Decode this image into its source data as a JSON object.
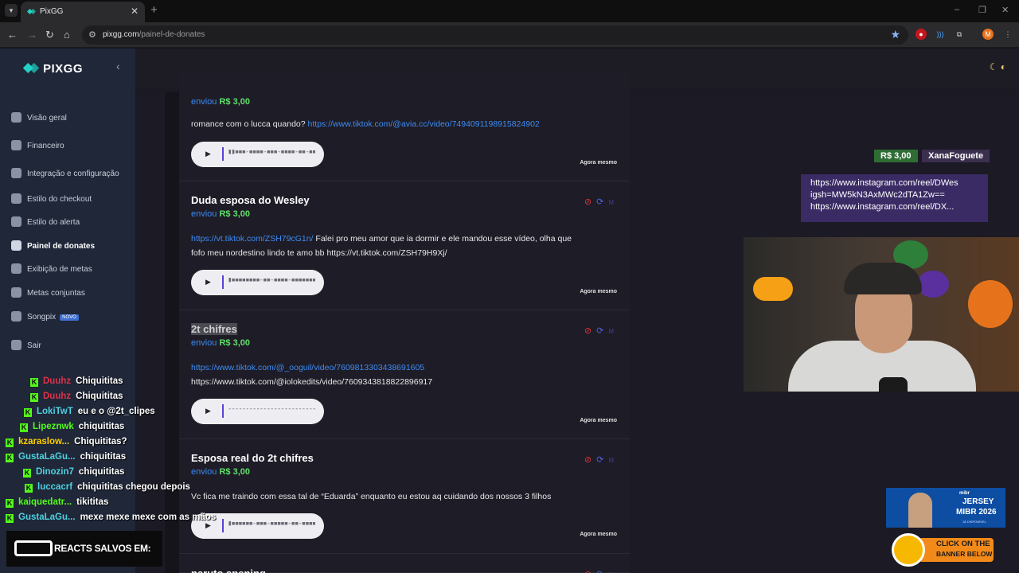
{
  "browser": {
    "tab_title": "PixGG",
    "tab_close": "✕",
    "new_tab": "+",
    "url_domain": "pixgg.com",
    "url_path": "/painel-de-donates",
    "profile_initial": "M",
    "window_controls": [
      "–",
      "❐",
      "✕"
    ]
  },
  "sidebar": {
    "logo": "PIXGG",
    "items": [
      {
        "label": "Visão geral",
        "icon": "home-icon"
      },
      {
        "label": "Financeiro",
        "icon": "wallet-icon"
      },
      {
        "label": "Integração e configuração",
        "icon": "settings-icon"
      },
      {
        "label": "Estilo do checkout",
        "icon": "palette-icon"
      },
      {
        "label": "Estilo do alerta",
        "icon": "palette-icon"
      },
      {
        "label": "Painel de donates",
        "icon": "panel-icon"
      },
      {
        "label": "Exibição de metas",
        "icon": "star-icon"
      },
      {
        "label": "Metas conjuntas",
        "icon": "users-icon"
      },
      {
        "label": "Songpix",
        "icon": "music-icon",
        "badge": "NOVO"
      },
      {
        "label": "Sair",
        "icon": "logout-icon"
      }
    ],
    "active_index": 5
  },
  "feed": {
    "cards": [
      {
        "donor": "",
        "sent_label": "enviou",
        "amount": "R$ 3,00",
        "message_text": "romance com o lucca quando? ",
        "message_link": "https://www.tiktok.com/@avia.cc/video/7494091198915824902",
        "message_line2": "",
        "waveform": "▮▮▪▪▪-▪▪▪▪-▪▪▪-▪▪▪▪-▪▪-▪▪▪-▪▪▪▪",
        "time": "Agora mesmo"
      },
      {
        "donor": "Duda esposa do Wesley",
        "sent_label": "enviou",
        "amount": "R$ 3,00",
        "message_link": "https://vt.tiktok.com/ZSH79cG1n/",
        "message_text": " Falei pro meu amor que ia dormir e ele mandou esse vídeo, olha que",
        "message_line2": "fofo meu nordestino lindo te amo bb https://vt.tiktok.com/ZSH79H9Xj/",
        "waveform": "▮▪▪▪▪▪▪▪▪-▪▪-▪▪▪▪-▪▪▪▪▪▪▪",
        "time": "Agora mesmo"
      },
      {
        "donor": "2t chifres",
        "sent_label": "enviou",
        "amount": "R$ 3,00",
        "message_link": "https://www.tiktok.com/@_ooguil/video/7609813303438691605",
        "message_text": "",
        "message_line2": "https://www.tiktok.com/@iolokedits/video/7609343818822896917",
        "waveform": "-------------------------",
        "time": "Agora mesmo"
      },
      {
        "donor": "Esposa real do 2t chifres",
        "sent_label": "enviou",
        "amount": "R$ 3,00",
        "message_link": "",
        "message_text": "Vc fica me traindo com essa tal de “Eduarda” enquanto eu estou aq cuidando dos nossos 3 filhos",
        "message_line2": "",
        "waveform": "▮▪▪▪▪▪▪-▪▪▪-▪▪▪▪▪-▪▪-▪▪▪▪",
        "time": "Agora mesmo"
      },
      {
        "donor": "naruto spening",
        "sent_label": "",
        "amount": "",
        "message_link": "",
        "message_text": "",
        "message_line2": "",
        "waveform": "",
        "time": ""
      }
    ],
    "action_glyphs": {
      "block": "⊘",
      "replay": "⟳",
      "mute": "M"
    },
    "play_glyph": "▶"
  },
  "alert": {
    "amount": "R$ 3,00",
    "name": "XanaFoguete",
    "lines": [
      "https://www.instagram.com/reel/DWes",
      "igsh=MW5kN3AxMWc2dTA1Zw==",
      "https://www.instagram.com/reel/DX..."
    ]
  },
  "chat": {
    "messages": [
      {
        "user": "Duuhz",
        "text": "Chiquititas",
        "color": "#e0304a",
        "indent": 38
      },
      {
        "user": "Duuhz",
        "text": "Chiquititas",
        "color": "#e0304a",
        "indent": 38
      },
      {
        "user": "LokiTwT",
        "text": "eu e o @2t_clipes",
        "color": "#4fd0e0",
        "indent": 30
      },
      {
        "user": "Lipeznwk",
        "text": "chiquititas",
        "color": "#53fc18",
        "indent": 25
      },
      {
        "user": "kzaraslow...",
        "text": "Chiquititas?",
        "color": "#ffd000",
        "indent": 7
      },
      {
        "user": "GustaLaGu...",
        "text": "chiquititas",
        "color": "#4fd0e0",
        "indent": 7
      },
      {
        "user": "Dinozin7",
        "text": "chiquititas",
        "color": "#4fd0e0",
        "indent": 29
      },
      {
        "user": "luccacrf",
        "text": "chiquititas chegou depois",
        "color": "#4fd0e0",
        "indent": 31
      },
      {
        "user": "kaiquedatr...",
        "text": "tikititas",
        "color": "#53fc18",
        "indent": 7
      },
      {
        "user": "GustaLaGu...",
        "text": "mexe mexe mexe com as mãos",
        "color": "#4fd0e0",
        "indent": 7
      }
    ],
    "badge_glyph": "K"
  },
  "reacts_banner": "REACTS SALVOS EM:",
  "ad": {
    "brand": "mibr",
    "line1": "JERSEY",
    "line2": "MIBR 2026",
    "line3": "JÁ DISPONÍVEL",
    "cta_line1": "CLICK ON THE",
    "cta_line2": "BANNER BELOW"
  }
}
